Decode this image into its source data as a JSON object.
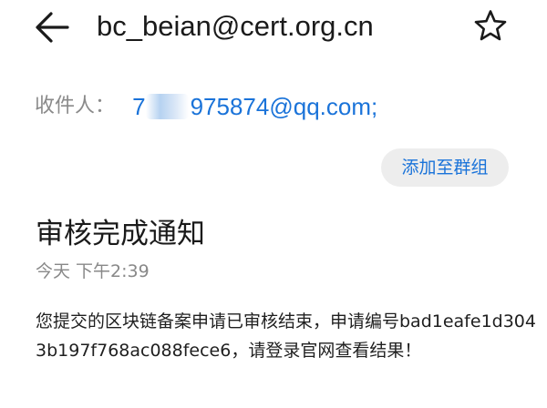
{
  "header": {
    "back_icon": "arrow-left-icon",
    "sender": "bc_beian@cert.org.cn",
    "star_icon": "star-outline-icon"
  },
  "recipients": {
    "label": "收件人：",
    "email": "7",
    "email_rest": "975874@qq.com;"
  },
  "actions": {
    "add_to_group": "添加至群组"
  },
  "message": {
    "subject": "审核完成通知",
    "time": "今天 下午2:39",
    "body": "您提交的区块链备案申请已审核结束，申请编号bad1eafe1d3043b197f768ac088fece6，请登录官网查看结果！"
  },
  "colors": {
    "accent": "#1a73d9",
    "muted_text": "#8a8a8a",
    "button_bg": "#ededed"
  }
}
